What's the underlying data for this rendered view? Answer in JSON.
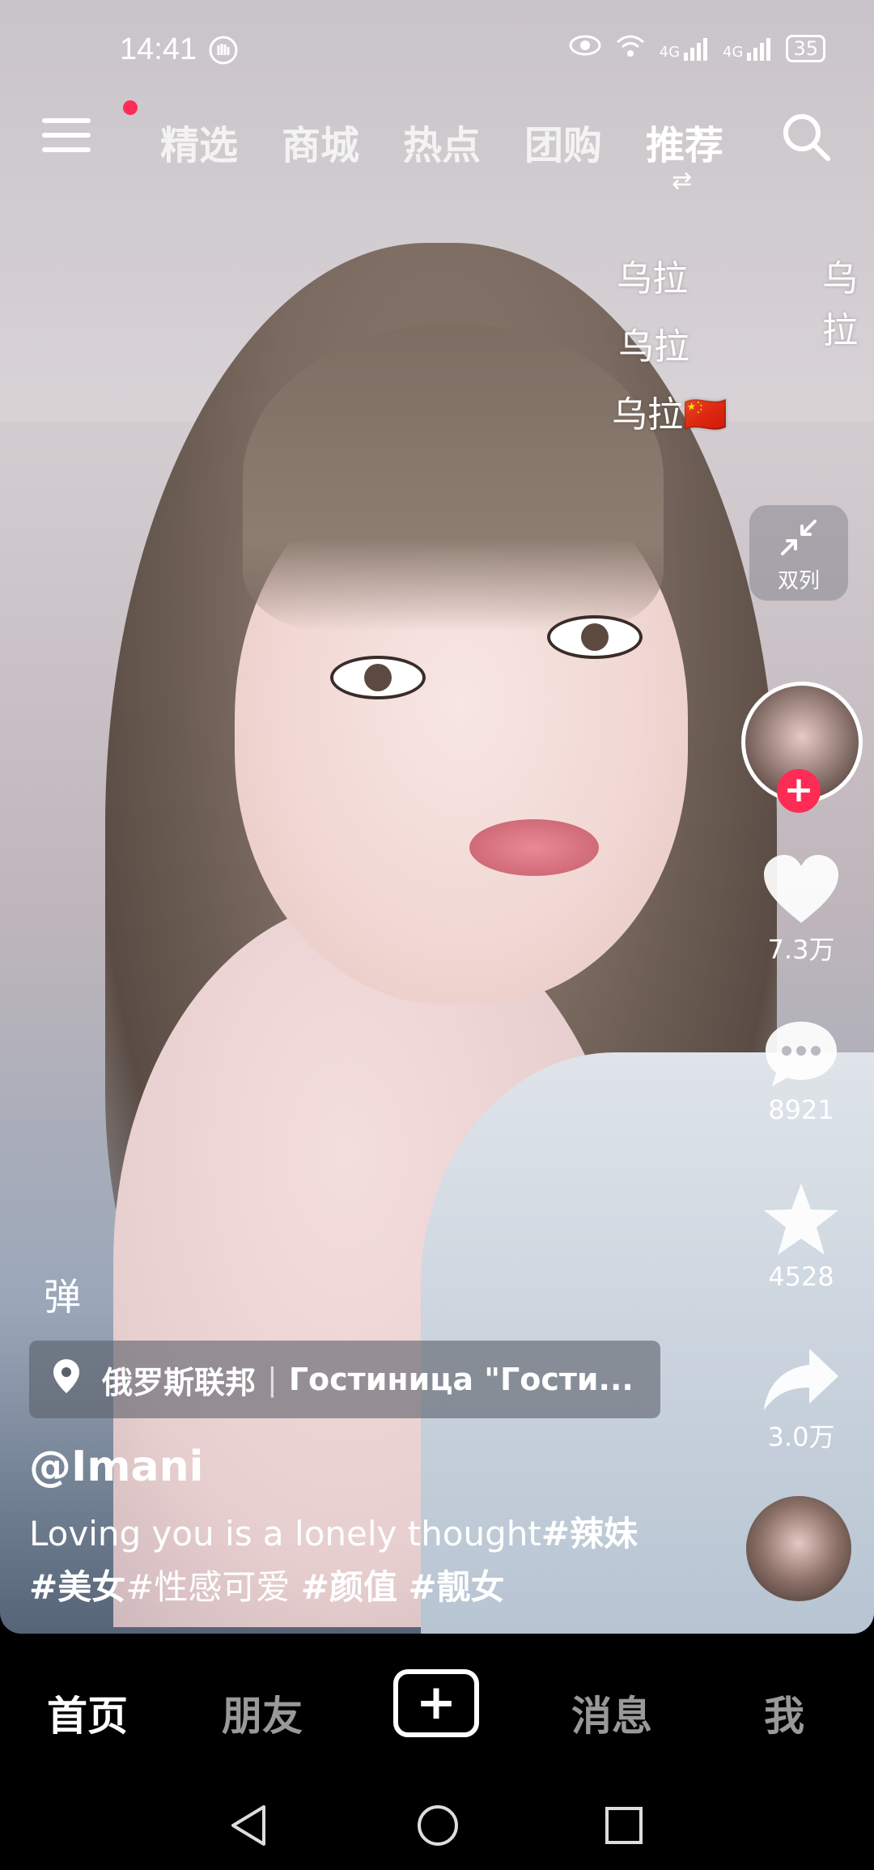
{
  "status_bar": {
    "time": "14:41",
    "signal_1": "4G",
    "signal_2": "4G",
    "battery": "35"
  },
  "top_nav": {
    "tabs": [
      {
        "label": "精选"
      },
      {
        "label": "商城"
      },
      {
        "label": "热点"
      },
      {
        "label": "团购"
      },
      {
        "label": "推荐"
      }
    ],
    "active_tab": "推荐"
  },
  "danmaku": [
    {
      "text": "乌拉"
    },
    {
      "text": "乌拉"
    },
    {
      "text": "乌拉"
    },
    {
      "text": "乌拉🇨🇳"
    }
  ],
  "side": {
    "dual_column_label": "双列",
    "likes": "7.3万",
    "comments": "8921",
    "favorites": "4528",
    "shares": "3.0万"
  },
  "video_info": {
    "barrage_label": "弹",
    "location_country": "俄罗斯联邦",
    "location_place": "Гостиница \"Гости...",
    "author": "@Imani",
    "caption_text": "Loving you is a lonely thought",
    "hashtags": [
      "#辣妹",
      "#美女",
      "#性感可爱",
      "#颜值",
      "#靓女"
    ]
  },
  "tab_bar": {
    "home": "首页",
    "friends": "朋友",
    "create": "+",
    "messages": "消息",
    "me": "我"
  },
  "colors": {
    "accent_red": "#fe2c55",
    "background": "#000000"
  }
}
